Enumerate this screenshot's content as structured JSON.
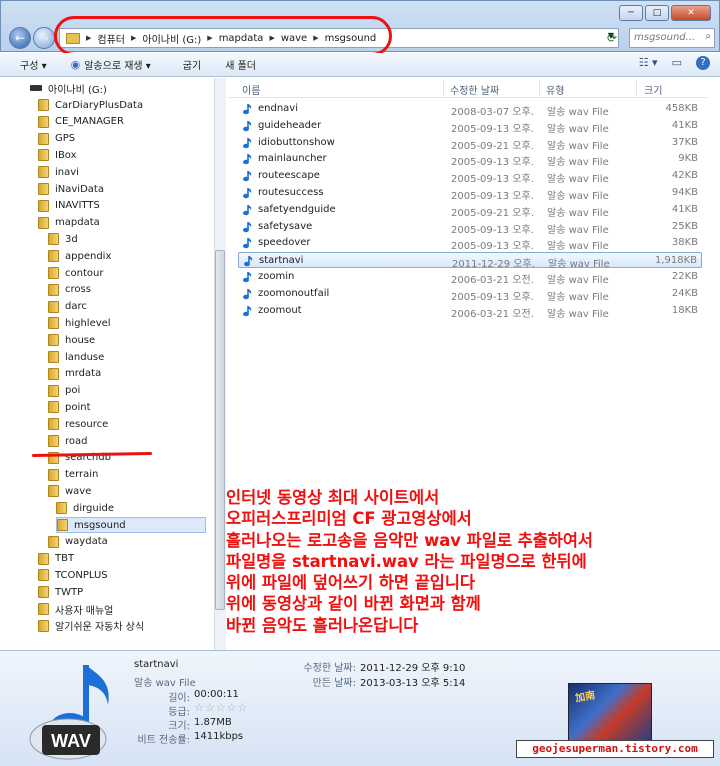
{
  "address": {
    "crumbs": [
      "컴퓨터",
      "아이나비 (G:)",
      "mapdata",
      "wave",
      "msgsound"
    ],
    "search_placeholder": "msgsound..."
  },
  "toolbar": {
    "organize": "구성 ▾",
    "play_with": "알송으로 재생 ▾",
    "burn": "굽기",
    "new_folder": "새 폴더"
  },
  "nav": {
    "drive": "아이나비 (G:)",
    "items": [
      {
        "label": "CarDiaryPlusData",
        "level": 1
      },
      {
        "label": "CE_MANAGER",
        "level": 1
      },
      {
        "label": "GPS",
        "level": 1
      },
      {
        "label": "IBox",
        "level": 1
      },
      {
        "label": "inavi",
        "level": 1
      },
      {
        "label": "iNaviData",
        "level": 1
      },
      {
        "label": "INAVITTS",
        "level": 1
      },
      {
        "label": "mapdata",
        "level": 1
      },
      {
        "label": "3d",
        "level": 2
      },
      {
        "label": "appendix",
        "level": 2
      },
      {
        "label": "contour",
        "level": 2
      },
      {
        "label": "cross",
        "level": 2
      },
      {
        "label": "darc",
        "level": 2
      },
      {
        "label": "highlevel",
        "level": 2
      },
      {
        "label": "house",
        "level": 2
      },
      {
        "label": "landuse",
        "level": 2
      },
      {
        "label": "mrdata",
        "level": 2
      },
      {
        "label": "poi",
        "level": 2
      },
      {
        "label": "point",
        "level": 2
      },
      {
        "label": "resource",
        "level": 2
      },
      {
        "label": "road",
        "level": 2
      },
      {
        "label": "searchdb",
        "level": 2
      },
      {
        "label": "terrain",
        "level": 2
      },
      {
        "label": "wave",
        "level": 2
      },
      {
        "label": "dirguide",
        "level": 3
      },
      {
        "label": "msgsound",
        "level": 3,
        "selected": true
      },
      {
        "label": "waydata",
        "level": 2
      },
      {
        "label": "TBT",
        "level": 1
      },
      {
        "label": "TCONPLUS",
        "level": 1
      },
      {
        "label": "TWTP",
        "level": 1
      },
      {
        "label": "사용자 매뉴얼",
        "level": 1
      },
      {
        "label": "알기쉬운 자동차 상식",
        "level": 1
      }
    ]
  },
  "columns": {
    "name": "이름",
    "date": "수정한 날짜",
    "type": "유형",
    "size": "크기"
  },
  "files": [
    {
      "name": "endnavi",
      "date": "2008-03-07 오후...",
      "type": "알송 wav File",
      "size": "458KB"
    },
    {
      "name": "guideheader",
      "date": "2005-09-13 오후...",
      "type": "알송 wav File",
      "size": "41KB"
    },
    {
      "name": "idiobuttonshow",
      "date": "2005-09-21 오후...",
      "type": "알송 wav File",
      "size": "37KB"
    },
    {
      "name": "mainlauncher",
      "date": "2005-09-13 오후...",
      "type": "알송 wav File",
      "size": "9KB"
    },
    {
      "name": "routeescape",
      "date": "2005-09-13 오후...",
      "type": "알송 wav File",
      "size": "42KB"
    },
    {
      "name": "routesuccess",
      "date": "2005-09-13 오후...",
      "type": "알송 wav File",
      "size": "94KB"
    },
    {
      "name": "safetyendguide",
      "date": "2005-09-21 오후...",
      "type": "알송 wav File",
      "size": "41KB"
    },
    {
      "name": "safetysave",
      "date": "2005-09-13 오후...",
      "type": "알송 wav File",
      "size": "25KB"
    },
    {
      "name": "speedover",
      "date": "2005-09-13 오후...",
      "type": "알송 wav File",
      "size": "38KB"
    },
    {
      "name": "startnavi",
      "date": "2011-12-29 오후...",
      "type": "알송 wav File",
      "size": "1,918KB",
      "selected": true
    },
    {
      "name": "zoomin",
      "date": "2006-03-21 오전...",
      "type": "알송 wav File",
      "size": "22KB"
    },
    {
      "name": "zoomonoutfail",
      "date": "2005-09-13 오후...",
      "type": "알송 wav File",
      "size": "24KB"
    },
    {
      "name": "zoomout",
      "date": "2006-03-21 오전...",
      "type": "알송 wav File",
      "size": "18KB"
    }
  ],
  "overlay_lines": [
    "인터넷 동영상 최대 사이트에서",
    "오피러스프리미엄 CF 광고영상에서",
    "흘러나오는 로고송을 음악만 wav 파일로 추출하여서",
    "파일명을 startnavi.wav 라는 파일명으로 한뒤에",
    "위에 파일에 덮어쓰기 하면 끝입니다",
    "위에 동영상과 같이 바뀐 화면과 함께",
    "바뀐 음악도 흘러나온답니다"
  ],
  "details": {
    "name": "startnavi",
    "type": "알송 wav File",
    "length_label": "길이:",
    "length": "00:00:11",
    "rating_label": "등급:",
    "rating_stars": "☆☆☆☆☆",
    "size_label": "크기:",
    "size": "1.87MB",
    "bitrate_label": "비트 전송률:",
    "bitrate": "1411kbps",
    "modified_label": "수정한 날짜:",
    "modified": "2011-12-29 오후 9:10",
    "created_label": "만든 날짜:",
    "created": "2013-03-13 오후 5:14",
    "icon_text": "WAV",
    "thumb_text": "加南"
  },
  "watermark": "geojesuperman.tistory.com"
}
